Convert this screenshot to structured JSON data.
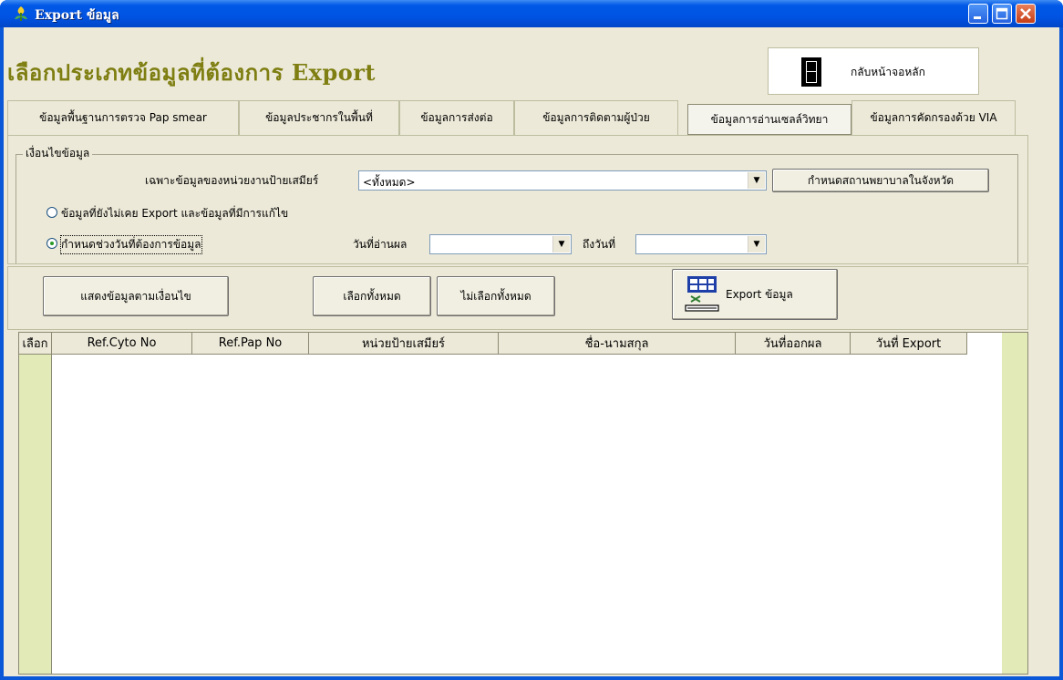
{
  "window": {
    "title": "Export ข้อมูล"
  },
  "header": {
    "title": "เลือกประเภทข้อมูลที่ต้องการ Export",
    "home_label": "กลับหน้าจอหลัก"
  },
  "tabs": [
    {
      "label": "ข้อมูลพื้นฐานการตรวจ Pap smear"
    },
    {
      "label": "ข้อมูลประชากรในพื้นที่"
    },
    {
      "label": "ข้อมูลการส่งต่อ"
    },
    {
      "label": "ข้อมูลการติดตามผู้ป่วย"
    },
    {
      "label": "ข้อมูลการอ่านเซลล์วิทยา"
    },
    {
      "label": "ข้อมูลการคัดกรองด้วย VIA"
    }
  ],
  "filter": {
    "group_label": "เงื่อนไขข้อมูล",
    "unit_label": "เฉพาะข้อมูลของหน่วยงานป้ายเสมียร์",
    "unit_value": "<ทั้งหมด>",
    "set_hospital_button": "กำหนดสถานพยาบาลในจังหวัด",
    "radio1_label": "ข้อมูลที่ยังไม่เคย Export และข้อมูลที่มีการแก้ไข",
    "radio2_label": "กำหนดช่วงวันที่ต้องการข้อมูล",
    "read_date_label": "วันที่อ่านผล",
    "to_date_label": "ถึงวันที่",
    "read_date_value": "",
    "to_date_value": ""
  },
  "actions": {
    "show_button": "แสดงข้อมูลตามเงื่อนไข",
    "select_all_button": "เลือกทั้งหมด",
    "deselect_all_button": "ไม่เลือกทั้งหมด",
    "export_button": "Export ข้อมูล"
  },
  "table": {
    "columns": [
      "เลือก",
      "Ref.Cyto No",
      "Ref.Pap No",
      "หน่วยป้ายเสมียร์",
      "ชื่อ-นามสกุล",
      "วันที่ออกผล",
      "วันที่ Export"
    ],
    "rows": []
  }
}
